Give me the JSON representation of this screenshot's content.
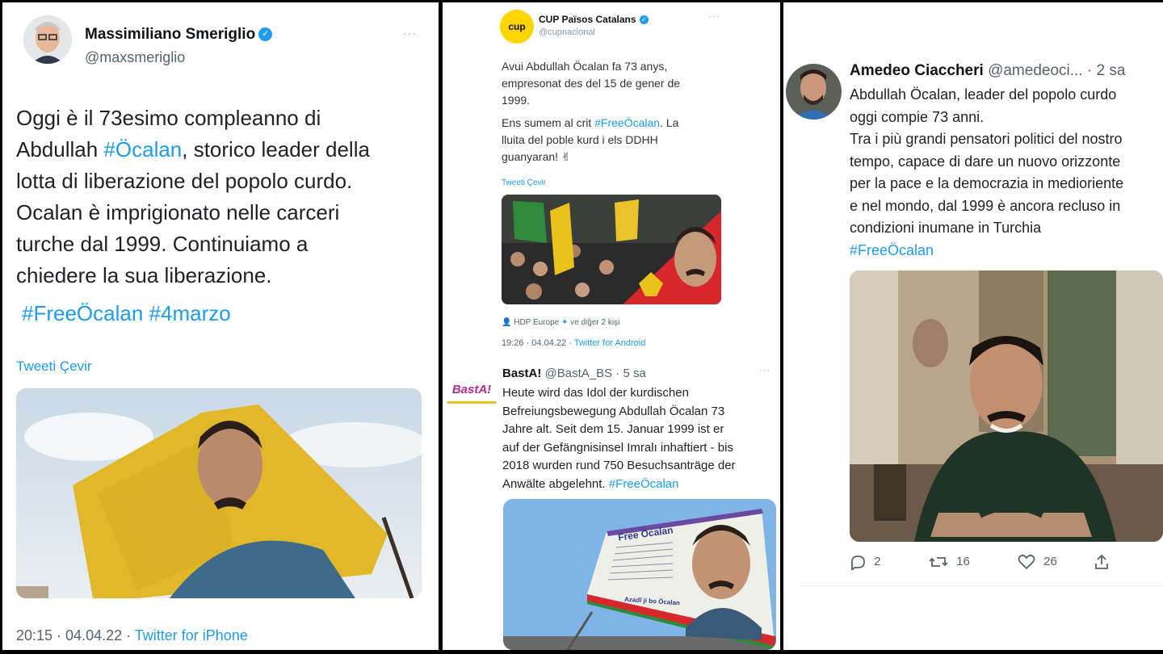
{
  "left_tweet": {
    "name": "Massimiliano Smeriglio",
    "handle": "@maxsmeriglio",
    "more": "···",
    "text_lines": [
      "Oggi è il 73esimo compleanno di",
      "storico leader della",
      "lotta di liberazione del popolo curdo.",
      "Ocalan è imprigionato nelle carceri",
      "turche dal 1999. Continuiamo a",
      "chiedere la sua liberazione."
    ],
    "line2_prefix": "Abdullah ",
    "line2_hashtag": "#Öcalan",
    "line2_suffix": ", storico leader della",
    "hashtag1": "#FreeÖcalan",
    "hashtag2": "#4marzo",
    "translate": "Tweeti Çevir",
    "time": "20:15 · 04.04.22 · ",
    "source": "Twitter for iPhone"
  },
  "middle_top_tweet": {
    "logo_text": "cup",
    "name": "CUP Països Catalans",
    "handle": "@cupnacional",
    "more": "···",
    "p1_lines": [
      "Avui Abdullah Öcalan fa 73 anys,",
      "empresonat des del 15 de gener de",
      "1999."
    ],
    "p2_prefix": "Ens sumem al crit ",
    "p2_hashtag": "#FreeÖcalan",
    "p2_suffix": ". La",
    "p2_lines": [
      "lluita del poble kurd i els DDHH",
      "guanyaran! ✌"
    ],
    "translate": "Tweeti Çevir",
    "tagged": "HDP Europe",
    "tagged_more": "ve diğer 2 kişi",
    "time": "19:26 · 04.04.22 · ",
    "source": "Twitter for Android"
  },
  "middle_bottom_tweet": {
    "logo_text": "BastA!",
    "name": "BastA!",
    "handle": "@BastA_BS · 5 sa",
    "more": "···",
    "lines": [
      "Heute wird das Idol der kurdischen",
      "Befreiungsbewegung Abdullah Öcalan 73",
      "Jahre alt. Seit dem 15. Januar 1999 ist er",
      "auf der Gefängnisinsel Imralı inhaftiert - bis",
      "2018 wurden rund 750 Besuchsanträge der"
    ],
    "last_prefix": "Anwälte abgelehnt. ",
    "last_hashtag": "#FreeÖcalan",
    "banner_title": "Free Öcalan",
    "banner_footer": "Azadî ji bo Öcalan"
  },
  "right_tweet": {
    "name": "Amedeo Ciaccheri",
    "handle": "@amedeoci... · 2 sa",
    "lines": [
      "Abdullah Öcalan, leader del popolo curdo",
      "oggi compie 73 anni.",
      "Tra i più grandi pensatori politici del nostro",
      "tempo, capace di dare un nuovo orizzonte",
      "per la pace e la democrazia in medioriente",
      "e nel mondo, dal 1999 è ancora recluso in",
      "condizioni inumane in Turchia"
    ],
    "hashtag": "#FreeÖcalan",
    "replies": "2",
    "retweets": "16",
    "likes": "26"
  },
  "colors": {
    "link": "#1d9bf0",
    "text": "#0f1419",
    "muted": "#536471",
    "verified": "#1d9bf0",
    "flag_yellow": "#e8c32a",
    "kurdish_red": "#d8262d"
  }
}
